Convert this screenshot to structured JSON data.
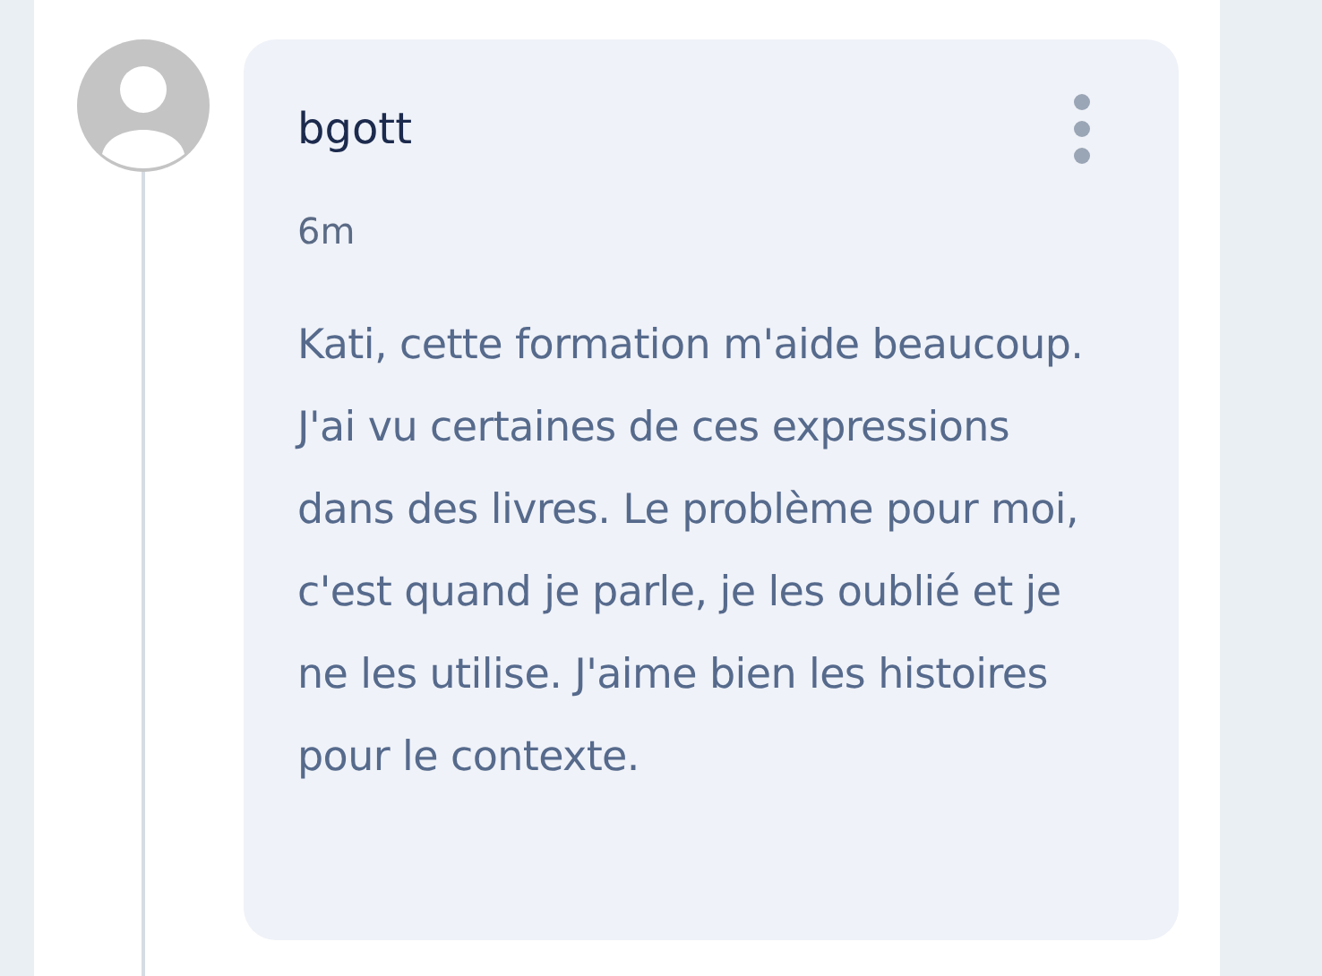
{
  "comment": {
    "author": "bgott",
    "time": "6m",
    "text": "Kati, cette formation m'aide beaucoup. J'ai vu certaines de ces expressions dans des livres. Le problème pour moi, c'est quand je parle, je les oublié et je ne les utilise. J'aime bien les histoires pour le contexte."
  }
}
